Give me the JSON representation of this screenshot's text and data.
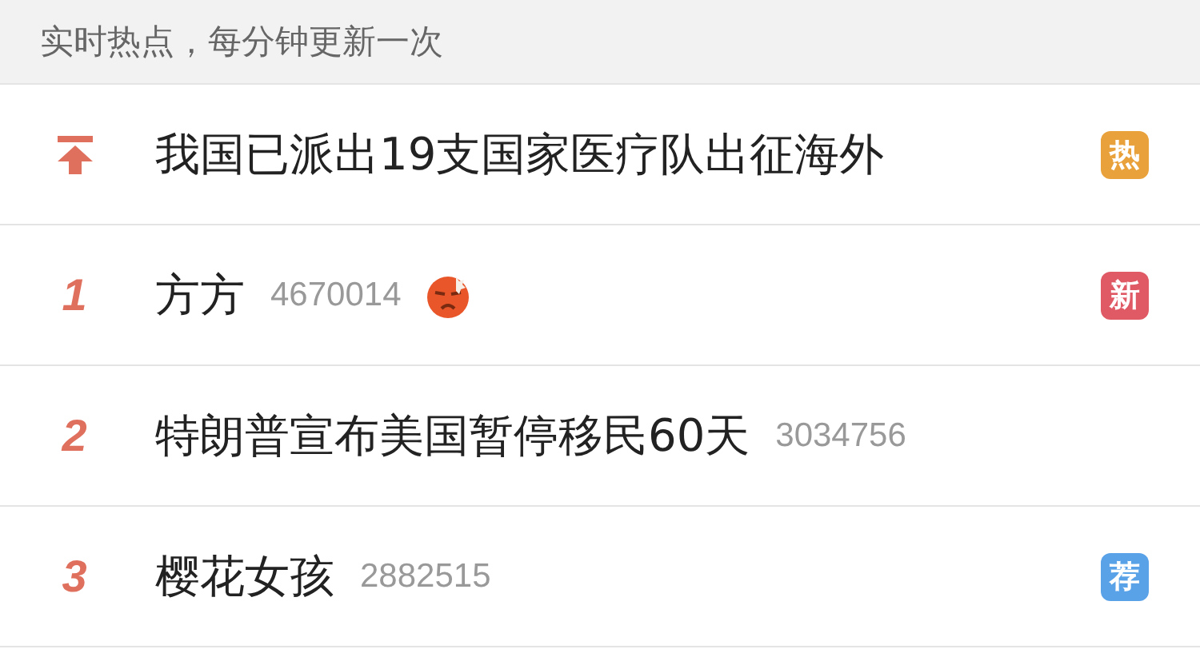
{
  "header": {
    "title": "实时热点，每分钟更新一次"
  },
  "items": [
    {
      "kind": "pinned",
      "title": "我国已派出19支国家医疗队出征海外",
      "badge": {
        "label": "热",
        "color": "#e9a23b"
      },
      "emoji": false
    },
    {
      "kind": "ranked",
      "rank": "1",
      "title": "方方",
      "count": "4670014",
      "badge": {
        "label": "新",
        "color": "#e05a66"
      },
      "emoji": true
    },
    {
      "kind": "ranked",
      "rank": "2",
      "title": "特朗普宣布美国暂停移民60天",
      "count": "3034756",
      "emoji": false
    },
    {
      "kind": "ranked",
      "rank": "3",
      "title": "樱花女孩",
      "count": "2882515",
      "badge": {
        "label": "荐",
        "color": "#5aa2e8"
      },
      "emoji": false
    }
  ]
}
